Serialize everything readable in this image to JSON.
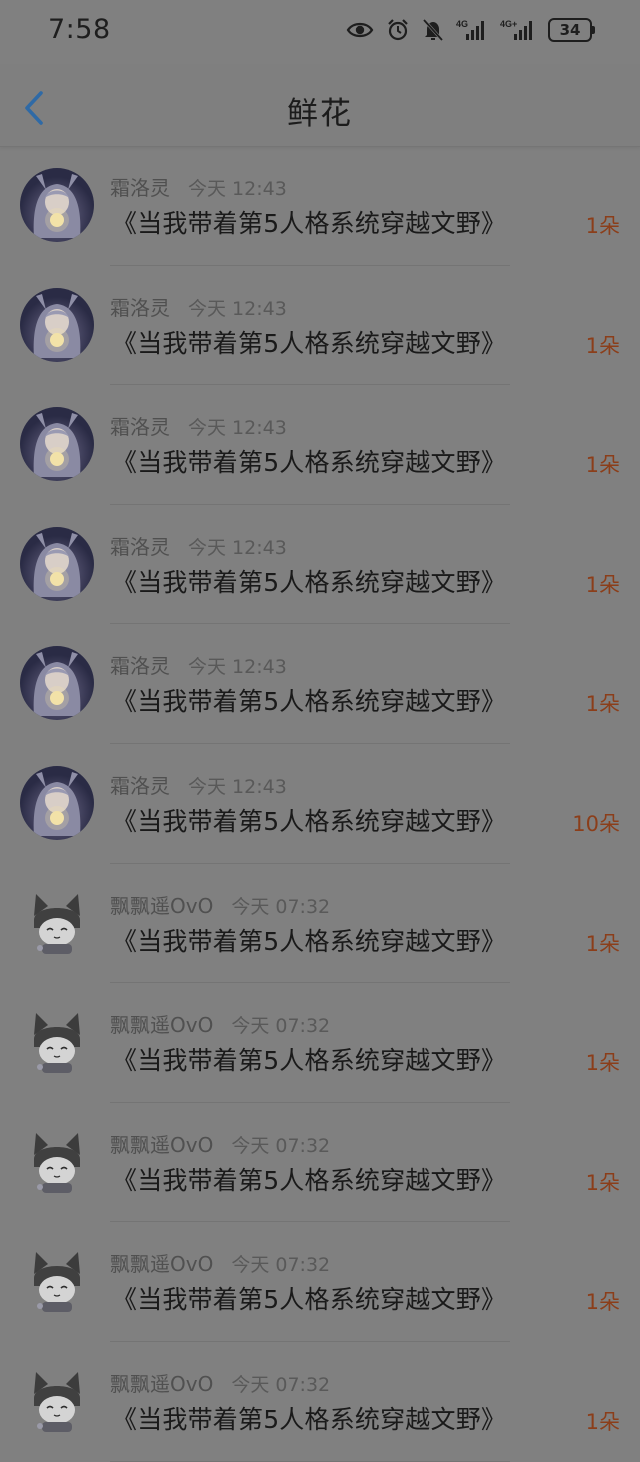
{
  "status_bar": {
    "time": "7:58",
    "battery": "34",
    "icons": [
      "eye-icon",
      "alarm-icon",
      "bell-off-icon",
      "signal-4g-icon",
      "signal-4g-icon"
    ]
  },
  "header": {
    "title": "鲜花",
    "back_icon": "chevron-left-icon",
    "accent": "#3a79b8"
  },
  "items": [
    {
      "user": "霜洛灵",
      "time": "今天 12:43",
      "book": "《当我带着第5人格系统穿越文野》",
      "count": "1朵",
      "avatar": "anime-girl-avatar"
    },
    {
      "user": "霜洛灵",
      "time": "今天 12:43",
      "book": "《当我带着第5人格系统穿越文野》",
      "count": "1朵",
      "avatar": "anime-girl-avatar"
    },
    {
      "user": "霜洛灵",
      "time": "今天 12:43",
      "book": "《当我带着第5人格系统穿越文野》",
      "count": "1朵",
      "avatar": "anime-girl-avatar"
    },
    {
      "user": "霜洛灵",
      "time": "今天 12:43",
      "book": "《当我带着第5人格系统穿越文野》",
      "count": "1朵",
      "avatar": "anime-girl-avatar"
    },
    {
      "user": "霜洛灵",
      "time": "今天 12:43",
      "book": "《当我带着第5人格系统穿越文野》",
      "count": "1朵",
      "avatar": "anime-girl-avatar"
    },
    {
      "user": "霜洛灵",
      "time": "今天 12:43",
      "book": "《当我带着第5人格系统穿越文野》",
      "count": "10朵",
      "avatar": "anime-girl-avatar"
    },
    {
      "user": "飘飘遥OvO",
      "time": "今天 07:32",
      "book": "《当我带着第5人格系统穿越文野》",
      "count": "1朵",
      "avatar": "cat-hood-avatar"
    },
    {
      "user": "飘飘遥OvO",
      "time": "今天 07:32",
      "book": "《当我带着第5人格系统穿越文野》",
      "count": "1朵",
      "avatar": "cat-hood-avatar"
    },
    {
      "user": "飘飘遥OvO",
      "time": "今天 07:32",
      "book": "《当我带着第5人格系统穿越文野》",
      "count": "1朵",
      "avatar": "cat-hood-avatar"
    },
    {
      "user": "飘飘遥OvO",
      "time": "今天 07:32",
      "book": "《当我带着第5人格系统穿越文野》",
      "count": "1朵",
      "avatar": "cat-hood-avatar"
    },
    {
      "user": "飘飘遥OvO",
      "time": "今天 07:32",
      "book": "《当我带着第5人格系统穿越文野》",
      "count": "1朵",
      "avatar": "cat-hood-avatar"
    }
  ]
}
